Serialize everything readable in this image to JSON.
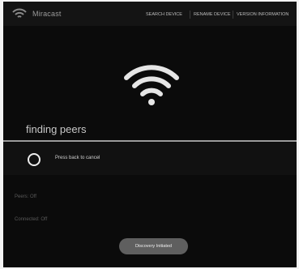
{
  "app": {
    "title": "Miracast",
    "icon": "wifi-icon"
  },
  "menu": {
    "search_label": "SEARCH DEVICE",
    "rename_label": "RENAME DEVICE",
    "version_label": "VERSION INFORMATION"
  },
  "status_icon": "wifi-icon",
  "dialog": {
    "title": "finding peers",
    "message": "Press back to cancel"
  },
  "peers": [
    "Peers: Off",
    "Connected: Off"
  ],
  "toast": {
    "text": "Discovery Initiated"
  },
  "colors": {
    "background": "#0b0b0b",
    "divider": "#9c9c9c",
    "toast": "#5f5f5f"
  }
}
